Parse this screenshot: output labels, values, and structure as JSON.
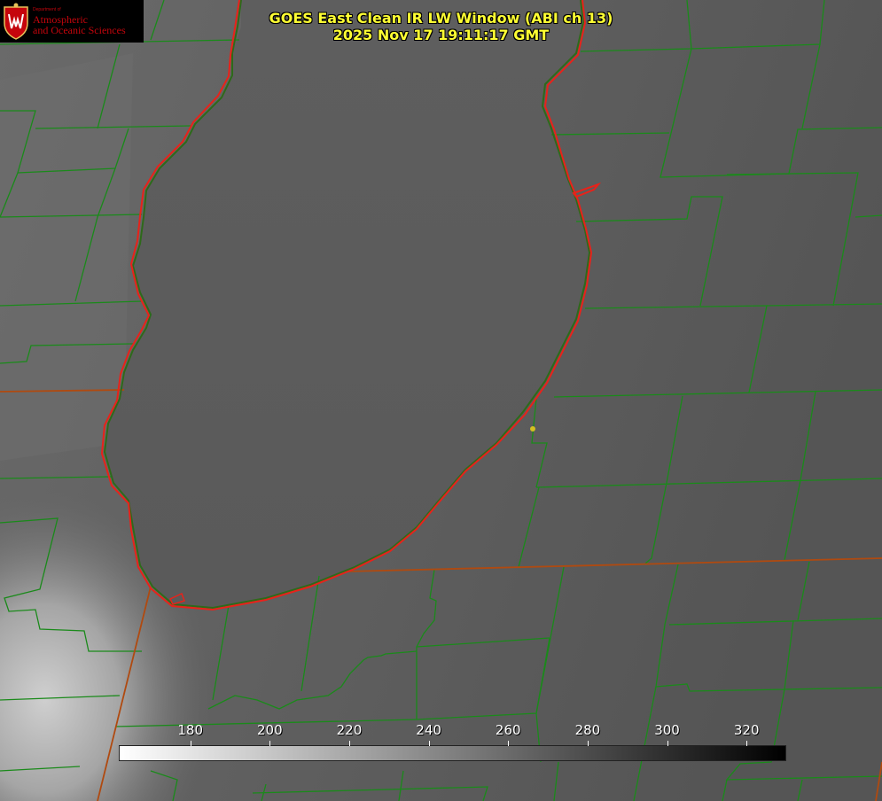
{
  "title": {
    "line1": "GOES East Clean IR LW Window (ABI ch 13)",
    "line2": "2025 Nov 17 19:11:17 GMT"
  },
  "logo": {
    "icon": "uw-crest-icon",
    "dept": "Department of",
    "line1": "Atmospheric",
    "line2": "and Oceanic Sciences",
    "color": "#c5050c"
  },
  "colorbar": {
    "ticks": [
      "180",
      "200",
      "220",
      "240",
      "260",
      "280",
      "300",
      "320"
    ],
    "range": [
      162,
      330
    ],
    "colors": [
      "#ffffff",
      "#000000"
    ]
  },
  "colors": {
    "lake_outline": "#e8221a",
    "county_lines": "#1a8a1a",
    "state_lines": "#b04a10",
    "marker": "#d4c020"
  }
}
